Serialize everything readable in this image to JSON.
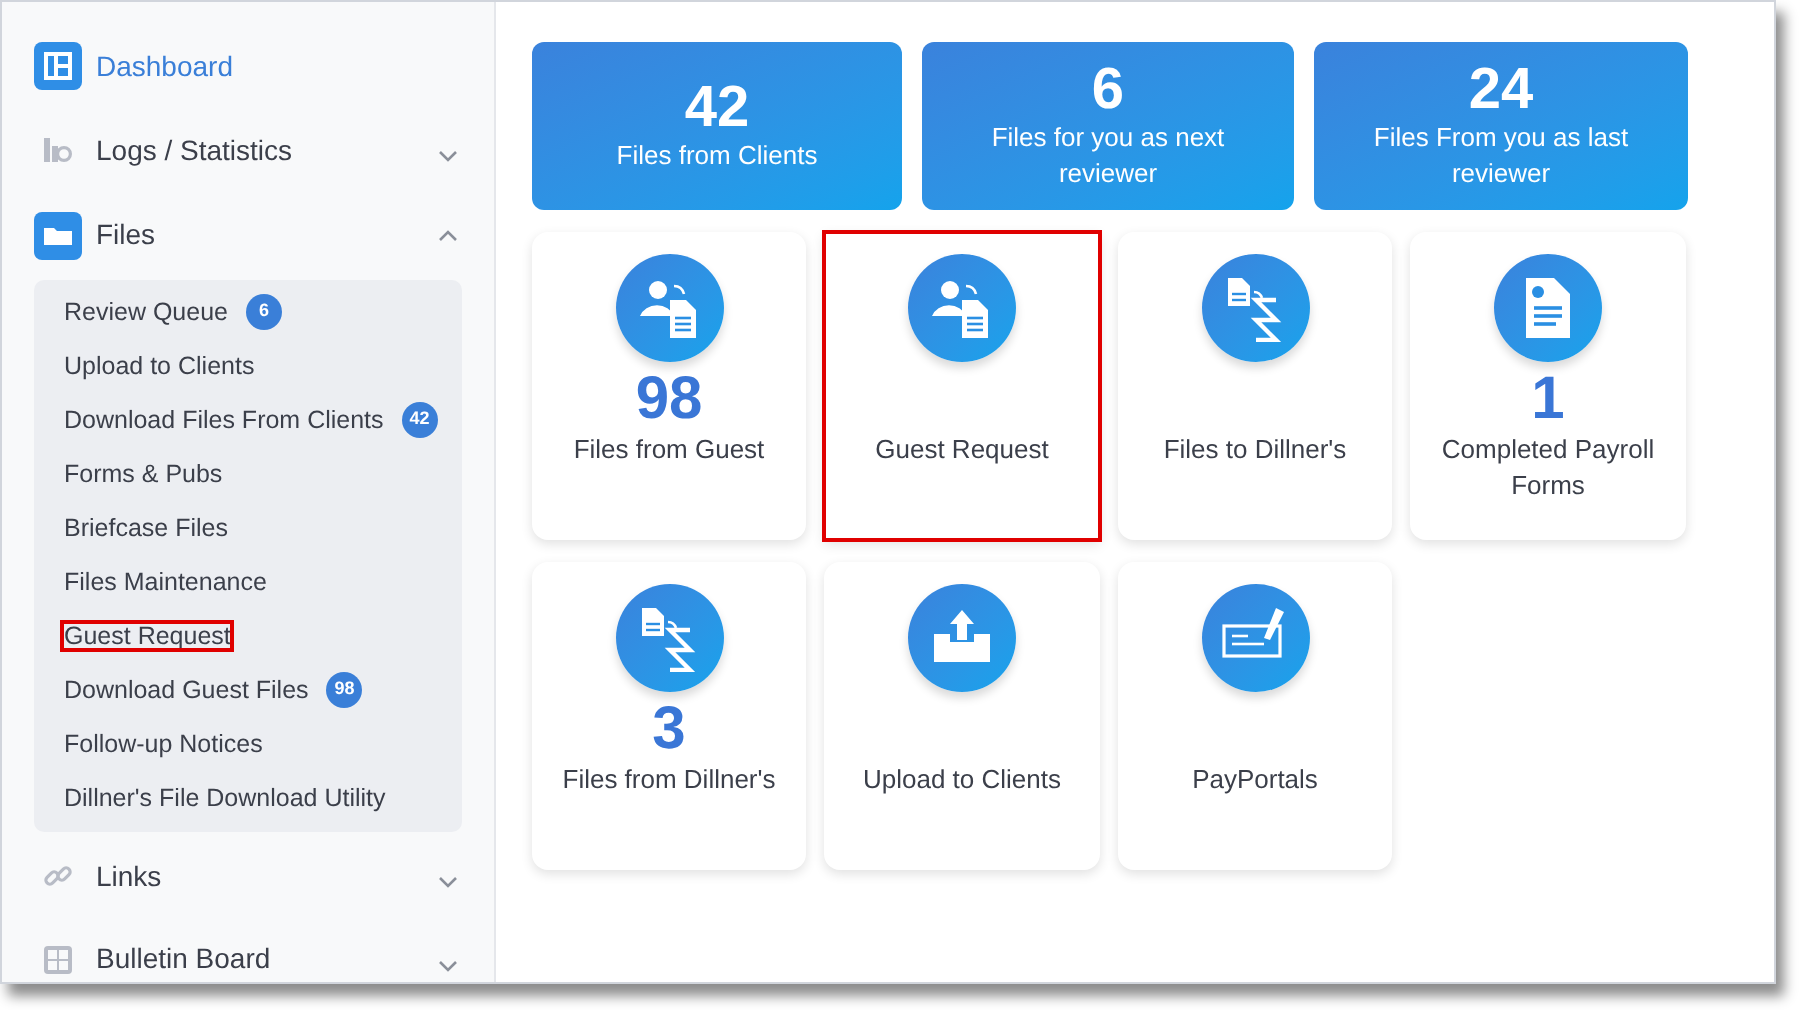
{
  "sidebar": {
    "items": [
      {
        "label": "Dashboard",
        "kind": "dashboard",
        "selected": true
      },
      {
        "label": "Logs / Statistics",
        "kind": "logs",
        "selected": false,
        "expanded": false
      },
      {
        "label": "Files",
        "kind": "folder",
        "selected": false,
        "expanded": true,
        "children": [
          {
            "label": "Review Queue",
            "badge": "6",
            "highlighted": false
          },
          {
            "label": "Upload to Clients",
            "highlighted": false
          },
          {
            "label": "Download Files From Clients",
            "badge": "42",
            "highlighted": false
          },
          {
            "label": "Forms & Pubs",
            "highlighted": false
          },
          {
            "label": "Briefcase Files",
            "highlighted": false
          },
          {
            "label": "Files Maintenance",
            "highlighted": false
          },
          {
            "label": "Guest Request",
            "highlighted": true
          },
          {
            "label": "Download Guest Files",
            "badge": "98",
            "highlighted": false
          },
          {
            "label": "Follow-up Notices",
            "highlighted": false
          },
          {
            "label": "Dillner's File Download Utility",
            "highlighted": false
          }
        ]
      },
      {
        "label": "Links",
        "kind": "link",
        "selected": false,
        "expanded": false
      },
      {
        "label": "Bulletin Board",
        "kind": "grid",
        "selected": false,
        "expanded": false
      }
    ]
  },
  "stats": [
    {
      "value": "42",
      "label": "Files from Clients"
    },
    {
      "value": "6",
      "label": "Files for you as next reviewer"
    },
    {
      "value": "24",
      "label": "Files From you as last reviewer"
    }
  ],
  "tiles": [
    {
      "kind": "person-file",
      "count": "98",
      "label": "Files from Guest",
      "highlighted": false
    },
    {
      "kind": "person-file",
      "label": "Guest Request",
      "highlighted": true
    },
    {
      "kind": "file-dollar",
      "label": "Files to Dillner's",
      "highlighted": false
    },
    {
      "kind": "form",
      "count": "1",
      "label": "Completed Payroll Forms",
      "highlighted": false
    },
    {
      "kind": "file-dollar",
      "count": "3",
      "label": "Files from Dillner's",
      "highlighted": false
    },
    {
      "kind": "upload",
      "label": "Upload to Clients",
      "highlighted": false
    },
    {
      "kind": "cheque",
      "label": "PayPortals",
      "highlighted": false
    }
  ]
}
